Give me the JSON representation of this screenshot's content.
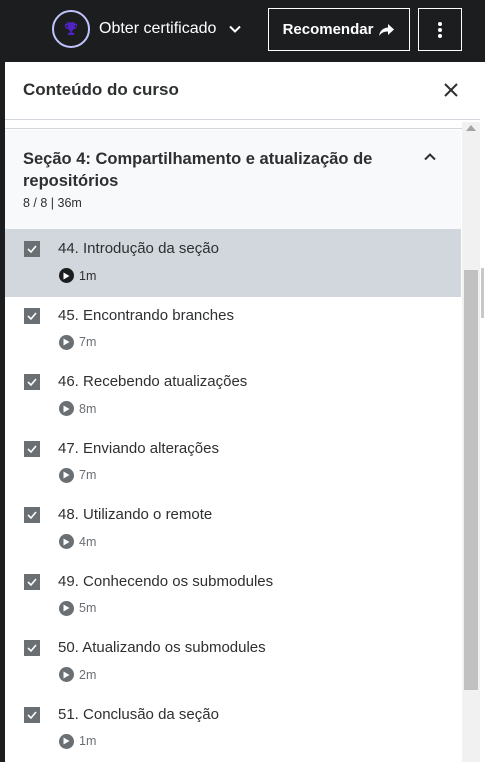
{
  "topbar": {
    "certificate_label": "Obter certificado",
    "recommend_label": "Recomendar"
  },
  "panel": {
    "title": "Conteúdo do curso"
  },
  "section": {
    "title": "Seção 4: Compartilhamento e atualização de repositórios",
    "meta": "8 / 8 | 36m"
  },
  "lessons": [
    {
      "title": "44. Introdução da seção",
      "duration": "1m",
      "completed": true,
      "active": true
    },
    {
      "title": "45. Encontrando branches",
      "duration": "7m",
      "completed": true,
      "active": false
    },
    {
      "title": "46. Recebendo atualizações",
      "duration": "8m",
      "completed": true,
      "active": false
    },
    {
      "title": "47. Enviando alterações",
      "duration": "7m",
      "completed": true,
      "active": false
    },
    {
      "title": "48. Utilizando o remote",
      "duration": "4m",
      "completed": true,
      "active": false
    },
    {
      "title": "49. Conhecendo os submodules",
      "duration": "5m",
      "completed": true,
      "active": false
    },
    {
      "title": "50. Atualizando os submodules",
      "duration": "2m",
      "completed": true,
      "active": false
    },
    {
      "title": "51. Conclusão da seção",
      "duration": "1m",
      "completed": true,
      "active": false
    }
  ],
  "colors": {
    "accent": "#5022c3",
    "trophy_ring": "#c0c4fc",
    "active_row": "#d1d7dc",
    "checkbox": "#6a6f73"
  },
  "icons": {
    "trophy": "trophy-icon",
    "chevron_down": "chevron-down-icon",
    "share": "share-arrow-icon",
    "more": "more-vertical-icon",
    "close": "close-icon",
    "chevron_up": "chevron-up-icon",
    "checkbox": "checkbox-checked-icon",
    "play": "play-icon"
  }
}
